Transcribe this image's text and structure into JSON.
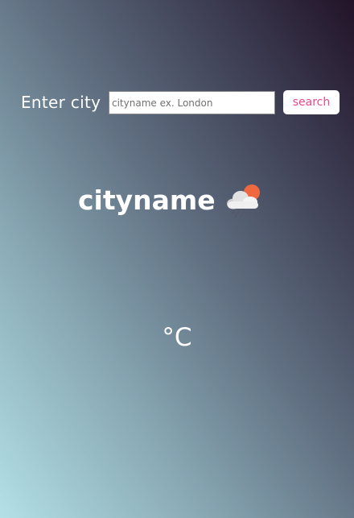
{
  "search": {
    "label": "Enter city",
    "placeholder": "cityname ex. London",
    "value": "",
    "button_label": "search"
  },
  "weather": {
    "city": "cityname",
    "icon": "sun-behind-rain-cloud-icon",
    "temperature": "",
    "unit": "°C"
  }
}
